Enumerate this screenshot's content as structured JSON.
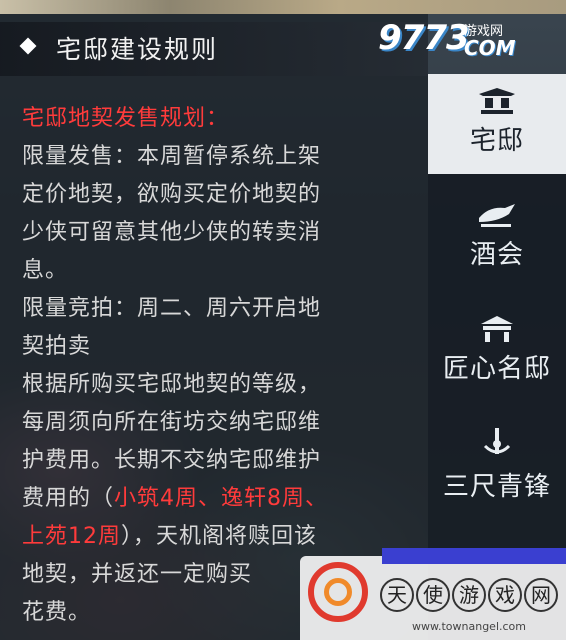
{
  "header": {
    "title": "宅邸建设规则"
  },
  "logo": {
    "number": "9773",
    "sub": "游戏网",
    "com": "COM"
  },
  "content": {
    "heading": "宅邸地契发售规划：",
    "lines": [
      "限量发售：本周暂停系统上架",
      "定价地契，欲购买定价地契的",
      "少侠可留意其他少侠的转卖消",
      "息。",
      "限量竞拍：周二、周六开启地",
      "契拍卖",
      "根据所购买宅邸地契的等级，",
      "每周须向所在街坊交纳宅邸维",
      "护费用。长期不交纳宅邸维护"
    ],
    "line10_pre": "费用的（",
    "line10_red": "小筑4周、逸轩8周、",
    "line11_red": "上苑12周",
    "line11_post": "），天机阁将赎回该",
    "line12": "地契，并返还一定购买",
    "line13": "花费。"
  },
  "tabs": [
    {
      "label": "宅邸",
      "icon": "house-icon",
      "active": true
    },
    {
      "label": "酒会",
      "icon": "banquet-icon",
      "active": false
    },
    {
      "label": "匠心名邸",
      "icon": "pavilion-icon",
      "active": false
    },
    {
      "label": "三尺青锋",
      "icon": "sword-icon",
      "active": false
    }
  ],
  "watermark": {
    "chars": [
      "天",
      "使",
      "游",
      "戏",
      "网"
    ],
    "site": "www.townangel.com"
  },
  "colors": {
    "accent_red": "#ff3b3b",
    "panel": "#1c2229",
    "active_tab": "#e8ebee"
  }
}
